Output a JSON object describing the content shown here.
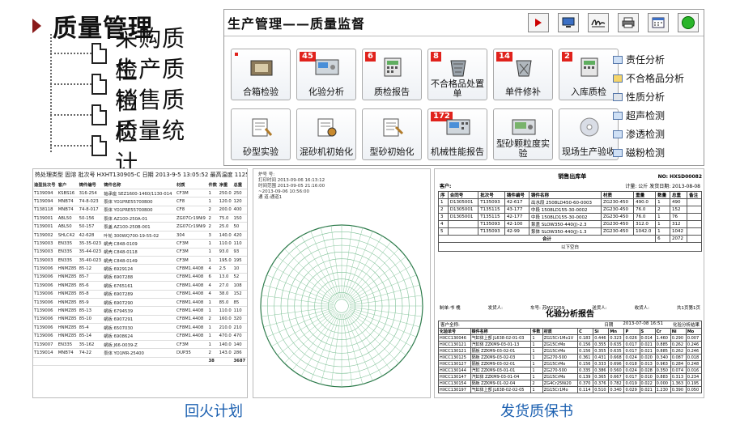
{
  "tree": {
    "root_label": "质量管理",
    "items": [
      "采购质检",
      "生产质检",
      "销售质检",
      "质量统计"
    ]
  },
  "panel": {
    "title": "生产管理——质量监督",
    "tiles": [
      {
        "label": "合箱检验",
        "badge": "",
        "icon": "mold-box-icon"
      },
      {
        "label": "化验分析",
        "badge": "45",
        "icon": "spectrometer-icon"
      },
      {
        "label": "质检报告",
        "badge": "6",
        "icon": "report-calculator-icon"
      },
      {
        "label": "不合格品处置单",
        "badge": "8",
        "icon": "waste-bin-icon"
      },
      {
        "label": "单件修补",
        "badge": "14",
        "icon": "repair-bin-icon"
      },
      {
        "label": "入库质检",
        "badge": "2",
        "icon": "inbound-calculator-icon"
      },
      {
        "label": "砂型实验",
        "badge": "",
        "icon": "sand-test-icon"
      },
      {
        "label": "混砂机初始化",
        "badge": "",
        "icon": "mixer-icon"
      },
      {
        "label": "型砂初始化",
        "badge": "",
        "icon": "molding-sand-icon"
      },
      {
        "label": "机械性能报告",
        "badge": "172",
        "icon": "mechanical-icon"
      },
      {
        "label": "型砂颗粒度实验",
        "badge": "",
        "icon": "grain-size-icon"
      },
      {
        "label": "现场生产验收",
        "badge": "",
        "icon": "disc-icon"
      }
    ],
    "side": [
      "责任分析",
      "不合格品分析",
      "性质分析",
      "超声检测",
      "渗透检测",
      "磁粉检测"
    ]
  },
  "toolbar": {
    "icons": [
      "play-icon",
      "monitor-icon",
      "signature-icon",
      "printer-icon",
      "calendar-icon",
      "smiley-icon"
    ]
  },
  "tempering": {
    "header": "热处理类型  固溶    批次号  HXHT130905-C  日期  2013-9-5 13:05:52    最高温度  1125    开机时间  2013-9-5    关机时间  2013-9-6",
    "columns": [
      "造型批次号",
      "客户",
      "铸件编号",
      "铸件名称",
      "材质",
      "件数",
      "净重",
      "总重"
    ],
    "rows": [
      [
        "T139094",
        "KSBS16",
        "316-254",
        "轴承座 SEZ1600-1460/1130-014",
        "CF3M",
        "1",
        "250.0",
        "250"
      ],
      [
        "T139094",
        "MNB74",
        "74-8-023",
        "泵体 YO1PRE55700B00",
        "CF8",
        "1",
        "120.0",
        "120"
      ],
      [
        "T138118",
        "MNB74",
        "74-8-017",
        "泵体 YO1PRE55700B00",
        "CF8",
        "2",
        "200.0",
        "400"
      ],
      [
        "T139001",
        "ABL50",
        "50-156",
        "泵体 AZ100-250A-01",
        "ZG07Cr19Ni9",
        "2",
        "75.0",
        "150"
      ],
      [
        "T139001",
        "ABL50",
        "50-157",
        "泵盖 AZ100-250B-001",
        "ZG07Cr19Ni9",
        "2",
        "25.0",
        "50"
      ],
      [
        "T139002",
        "SHLC42",
        "42-628",
        "叶轮 300WQ700-19-55-02",
        "304",
        "3",
        "140.0",
        "420"
      ],
      [
        "T139003",
        "EN335",
        "35-35-023",
        "蜗壳 C848-0109",
        "CF3M",
        "1",
        "110.0",
        "110"
      ],
      [
        "T139003",
        "EN335",
        "35-44-023",
        "蜗壳 C848-0118",
        "CF3M",
        "1",
        "93.0",
        "93"
      ],
      [
        "T139003",
        "EN335",
        "35-40-023",
        "蜗壳 C848-0149",
        "CF3M",
        "1",
        "195.0",
        "195"
      ],
      [
        "T139006",
        "HNMZ85",
        "85-12",
        "蜗板 6929124",
        "CF8M1.4408",
        "4",
        "2.5",
        "10"
      ],
      [
        "T139006",
        "HNMZ85",
        "85-7",
        "蜗板 6907288",
        "CF8M1.4408",
        "6",
        "13.0",
        "52"
      ],
      [
        "T139006",
        "HNMZ85",
        "85-6",
        "蜗板 6765161",
        "CF8M1.4408",
        "4",
        "27.0",
        "108"
      ],
      [
        "T139006",
        "HNMZ85",
        "85-8",
        "蜗板 6907289",
        "CF8M1.4408",
        "4",
        "38.0",
        "152"
      ],
      [
        "T139006",
        "HNMZ85",
        "85-9",
        "蜗板 6907290",
        "CF8M1.4408",
        "1",
        "85.0",
        "85"
      ],
      [
        "T139006",
        "HNMZ85",
        "85-13",
        "蜗板 6794539",
        "CF8M1.4408",
        "1",
        "110.0",
        "110"
      ],
      [
        "T139006",
        "HNMZ85",
        "85-10",
        "蜗板 6907291",
        "CF8M1.4408",
        "2",
        "160.0",
        "320"
      ],
      [
        "T139006",
        "HNMZ85",
        "85-4",
        "蜗板 6507030",
        "CF8M1.4408",
        "1",
        "210.0",
        "210"
      ],
      [
        "T139006",
        "HNMZ85",
        "85-14",
        "蜗板 6908624",
        "CF8M1.4408",
        "1",
        "470.0",
        "470"
      ],
      [
        "T139007",
        "EN335",
        "35-162",
        "蜗板 J66-0039-Z",
        "CF3M",
        "1",
        "140.0",
        "140"
      ],
      [
        "T139014",
        "MNB74",
        "74-22",
        "泵体 YO1MR-25400",
        "DUP35",
        "2",
        "143.0",
        "286"
      ]
    ],
    "total_count": "38",
    "total_weight": "3687"
  },
  "curve": {
    "meta": [
      "炉号 号:",
      "打印时间 2013-09-06  16:13:12",
      "时间范围 2013-09-05  21:16:00",
      "~2013-09-06  10:56:00",
      "通  道:通道1"
    ]
  },
  "shipping": {
    "title": "销售出库单",
    "no_label": "NO: HXSD00082",
    "customer_label": "客户:",
    "meta_right": "计量: 公斤  发货日期: 2013-08-08",
    "columns": [
      "序",
      "合同号",
      "批次号",
      "铸件编号",
      "铸件名称",
      "材质",
      "重量",
      "数量",
      "总重",
      "备注"
    ],
    "rows": [
      [
        "1",
        "D1305001",
        "T135093",
        "42-617",
        "出水段 2508LD450-60-0003",
        "ZG230-450",
        "490.0",
        "1",
        "490",
        ""
      ],
      [
        "2",
        "D1305001",
        "T135115",
        "43-177",
        "中段 1508LD155-30-0002",
        "ZG230-450",
        "76.0",
        "2",
        "152",
        ""
      ],
      [
        "3",
        "D1305001",
        "T135115",
        "42-177",
        "中段 1508LD155-30-0002",
        "ZG230-450",
        "76.0",
        "1",
        "76",
        ""
      ],
      [
        "4",
        "",
        "T135093",
        "42-100",
        "泵盖 SLOW350-440(J)-2.3",
        "ZG230-450",
        "312.0",
        "1",
        "312",
        ""
      ],
      [
        "5",
        "",
        "T135093",
        "42-99",
        "泵体 SLOW350-440(J)-1.3",
        "ZG230-450",
        "1042.0",
        "1",
        "1042",
        ""
      ]
    ],
    "sum_label": "合计",
    "sum_count": "6",
    "sum_weight": "2072",
    "blank_label": "以下空白",
    "footer": [
      "制单:书  槐",
      "发货人:",
      "车号: 苏M27259",
      "送货人:",
      "收货人:",
      "共1页第1页"
    ]
  },
  "analysis": {
    "title": "化验分析报告",
    "customer": "客户全称:",
    "date_label": "日期",
    "date_value": "2013-07-08 16:51",
    "result_label": "化验分析结果",
    "columns": [
      "化验单号",
      "铸件名称",
      "件数",
      "材质",
      "C",
      "Si",
      "Mn",
      "P",
      "S",
      "Cr",
      "Ni",
      "Mo"
    ],
    "rows": [
      [
        "HXCC130046",
        "气缸体上部 JL638-02-01-03",
        "1",
        "ZG15Cr1Mo1V",
        "0.183",
        "0.446",
        "0.323",
        "0.026",
        "0.014",
        "1.460",
        "0.290",
        "0.007"
      ],
      [
        "HXCC130121",
        "汽缸体 ZZKM9-03-01-13",
        "1",
        "ZG15CrMo",
        "0.156",
        "0.355",
        "0.635",
        "0.017",
        "0.021",
        "0.885",
        "0.262",
        "0.246"
      ],
      [
        "HXCC130121",
        "隔板 ZZKM9-03-02-01",
        "1",
        "ZG15CrMo",
        "0.156",
        "0.355",
        "0.635",
        "0.017",
        "0.021",
        "0.885",
        "0.262",
        "0.246"
      ],
      [
        "HXCC130125",
        "隔板 ZZKM9-03-02-03",
        "1",
        "ZG270-500",
        "0.361",
        "0.431",
        "0.668",
        "0.024",
        "0.020",
        "0.340",
        "0.087",
        "0.018"
      ],
      [
        "HXCC130127",
        "隔板 ZZKM9-03-02-01",
        "1",
        "ZG15CrMo",
        "0.156",
        "0.333",
        "0.696",
        "0.018",
        "0.013",
        "0.963",
        "0.284",
        "0.248"
      ],
      [
        "HXCC130144",
        "汽缸 ZZKM9-03-01-01",
        "1",
        "ZG270-500",
        "0.335",
        "0.386",
        "0.560",
        "0.024",
        "0.028",
        "0.350",
        "0.074",
        "0.016"
      ],
      [
        "HXCC130147",
        "汽缸体 ZZKM9-03-01-04",
        "1",
        "ZG15CrMo",
        "0.139",
        "0.365",
        "0.667",
        "0.017",
        "0.010",
        "0.883",
        "0.313",
        "0.234"
      ],
      [
        "HXCC130154",
        "隔板 ZZKM9-01-02-04",
        "2",
        "ZG4Cr25Ni20",
        "0.370",
        "0.376",
        "0.782",
        "0.019",
        "0.022",
        "0.000",
        "1.363",
        "0.195"
      ],
      [
        "HXCC130197",
        "气缸体上部 JL638-02-02-05",
        "1",
        "ZG15Cr1Mo",
        "0.114",
        "0.510",
        "0.340",
        "0.029",
        "0.021",
        "1.230",
        "0.390",
        "0.050"
      ]
    ]
  },
  "captions": [
    "回火计划",
    "发货质保书"
  ]
}
